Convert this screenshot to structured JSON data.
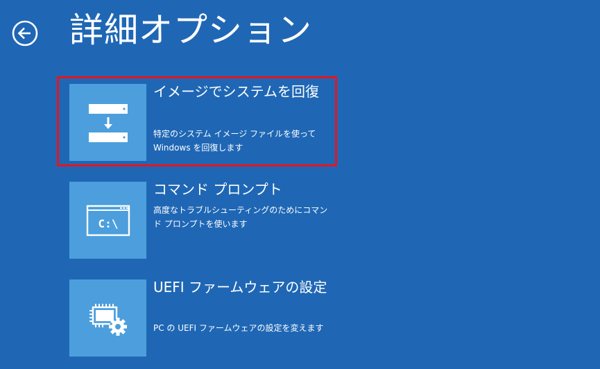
{
  "header": {
    "back_icon": "arrow-left-circle-icon",
    "title": "詳細オプション"
  },
  "options": [
    {
      "icon": "system-image-restore-icon",
      "title": "イメージでシステムを回復",
      "description": "特定のシステム イメージ ファイルを使って Windows を回復します",
      "selected": true
    },
    {
      "icon": "command-prompt-icon",
      "icon_text": "C:\\",
      "title": "コマンド プロンプト",
      "description": "高度なトラブルシューティングのためにコマンド プロンプトを使います"
    },
    {
      "icon": "uefi-firmware-settings-icon",
      "title": "UEFI ファームウェアの設定",
      "description": "PC の UEFI ファームウェアの設定を変えます"
    }
  ],
  "colors": {
    "background": "#1f67b5",
    "tile": "#4c9fdc",
    "text": "#ffffff",
    "selection_border": "#e8141e"
  }
}
